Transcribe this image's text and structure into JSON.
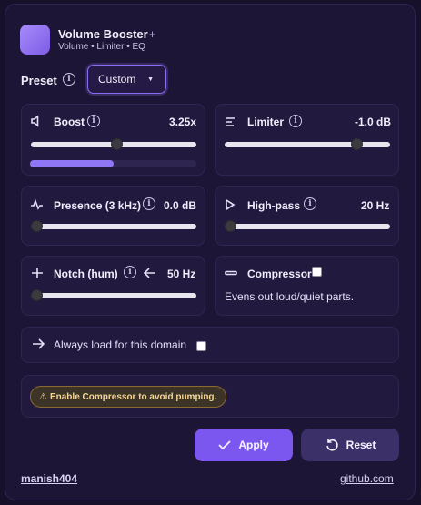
{
  "header": {
    "title": "Volume Booster",
    "title_plus": "+",
    "subtitle": "Volume • Limiter • EQ"
  },
  "preset": {
    "label": "Preset",
    "selected": "Custom"
  },
  "boost": {
    "label": "Boost",
    "value": "3.25x",
    "slider_fraction": 0.52,
    "meter_fraction": 0.5
  },
  "limiter": {
    "label": "Limiter",
    "value": "-1.0 dB",
    "slider_fraction": 0.82
  },
  "presence": {
    "label": "Presence (3 kHz)",
    "value": "0.0 dB",
    "slider_fraction": 0.0
  },
  "highpass": {
    "label": "High-pass",
    "value": "20 Hz",
    "slider_fraction": 0.0
  },
  "notch": {
    "label": "Notch (hum)",
    "value": "50 Hz",
    "slider_fraction": 0.0
  },
  "compressor": {
    "label": "Compressor",
    "checked": false,
    "description": "Evens out loud/quiet parts."
  },
  "always_load": {
    "label": "Always load for this domain",
    "checked": false
  },
  "warning": {
    "text": "Enable Compressor to avoid pumping."
  },
  "buttons": {
    "apply": "Apply",
    "reset": "Reset"
  },
  "footer": {
    "user": "manish404",
    "link": "github.com"
  },
  "colors": {
    "accent": "#7b57f0",
    "background": "#17102b",
    "card": "#22193f",
    "warning": "#f3d59a"
  },
  "icons": [
    "volume-icon",
    "limiter-icon",
    "pulse-icon",
    "play-icon",
    "plus-icon",
    "arrow-left-icon",
    "minus-icon",
    "arrow-right-icon",
    "warning-icon",
    "check-icon",
    "reset-icon",
    "info-icon"
  ]
}
